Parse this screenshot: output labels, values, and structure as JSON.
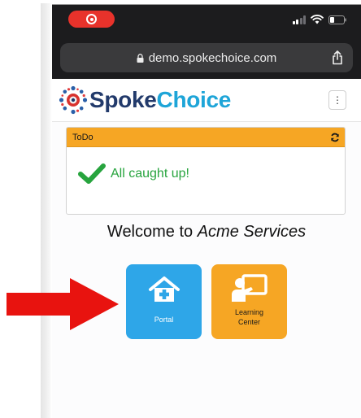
{
  "browser": {
    "url": "demo.spokechoice.com"
  },
  "header": {
    "logo_part1": "Spoke",
    "logo_part2": "Choice",
    "menu_icon": "⋮"
  },
  "todo": {
    "title": "ToDo",
    "message": "All caught up!"
  },
  "welcome": {
    "prefix": "Welcome to ",
    "company": "Acme Services"
  },
  "tiles": [
    {
      "label": "Portal",
      "icon": "home-plus-icon",
      "color": "#2ea6e8"
    },
    {
      "label_line1": "Learning",
      "label_line2": "Center",
      "icon": "presenter-icon",
      "color": "#f6a624"
    }
  ],
  "colors": {
    "status_bar": "#1c1c1e",
    "record_pill": "#e8322b",
    "todo_header": "#f6a624",
    "success_green": "#27a43e",
    "pointer_arrow": "#e8130f"
  }
}
